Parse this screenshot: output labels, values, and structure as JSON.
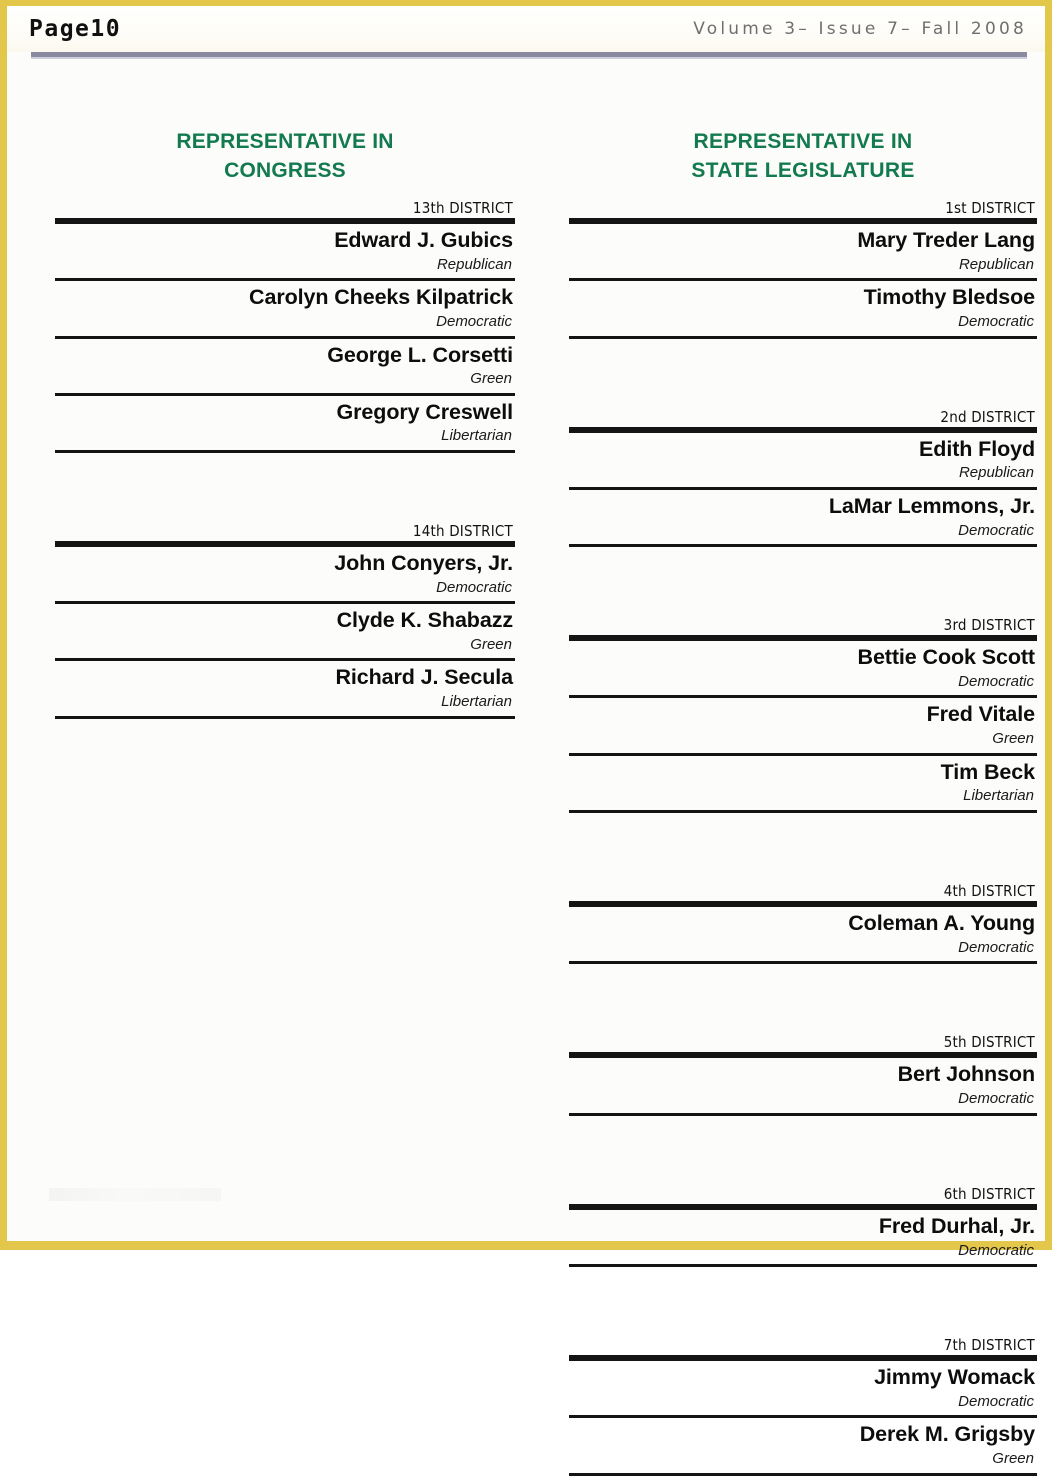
{
  "header": {
    "page_label": "Page10",
    "issue_line": "Volume 3– Issue 7– Fall 2008"
  },
  "colors": {
    "office_title": "#137a4f",
    "border": "#e3c74a",
    "rule": "#141414",
    "masthead_rule": "#8a8aa0"
  },
  "columns": [
    {
      "office_title": "REPRESENTATIVE IN\nCONGRESS",
      "districts": [
        {
          "label": "13th DISTRICT",
          "candidates": [
            {
              "name": "Edward J. Gubics",
              "party": "Republican"
            },
            {
              "name": "Carolyn Cheeks Kilpatrick",
              "party": "Democratic"
            },
            {
              "name": "George L. Corsetti",
              "party": "Green"
            },
            {
              "name": "Gregory Creswell",
              "party": "Libertarian"
            }
          ]
        },
        {
          "label": "14th DISTRICT",
          "candidates": [
            {
              "name": "John Conyers, Jr.",
              "party": "Democratic"
            },
            {
              "name": "Clyde K. Shabazz",
              "party": "Green"
            },
            {
              "name": "Richard J. Secula",
              "party": "Libertarian"
            }
          ]
        }
      ]
    },
    {
      "office_title": "REPRESENTATIVE IN\nSTATE LEGISLATURE",
      "districts": [
        {
          "label": "1st DISTRICT",
          "candidates": [
            {
              "name": "Mary Treder Lang",
              "party": "Republican"
            },
            {
              "name": "Timothy Bledsoe",
              "party": "Democratic"
            }
          ]
        },
        {
          "label": "2nd DISTRICT",
          "candidates": [
            {
              "name": "Edith Floyd",
              "party": "Republican"
            },
            {
              "name": "LaMar Lemmons, Jr.",
              "party": "Democratic"
            }
          ]
        },
        {
          "label": "3rd DISTRICT",
          "candidates": [
            {
              "name": "Bettie Cook Scott",
              "party": "Democratic"
            },
            {
              "name": "Fred Vitale",
              "party": "Green"
            },
            {
              "name": "Tim Beck",
              "party": "Libertarian"
            }
          ]
        },
        {
          "label": "4th DISTRICT",
          "candidates": [
            {
              "name": "Coleman A. Young",
              "party": "Democratic"
            }
          ]
        },
        {
          "label": "5th DISTRICT",
          "candidates": [
            {
              "name": "Bert Johnson",
              "party": "Democratic"
            }
          ]
        },
        {
          "label": "6th DISTRICT",
          "candidates": [
            {
              "name": "Fred Durhal, Jr.",
              "party": "Democratic"
            }
          ]
        },
        {
          "label": "7th DISTRICT",
          "candidates": [
            {
              "name": "Jimmy Womack",
              "party": "Democratic"
            },
            {
              "name": "Derek M. Grigsby",
              "party": "Green"
            }
          ]
        }
      ]
    }
  ]
}
